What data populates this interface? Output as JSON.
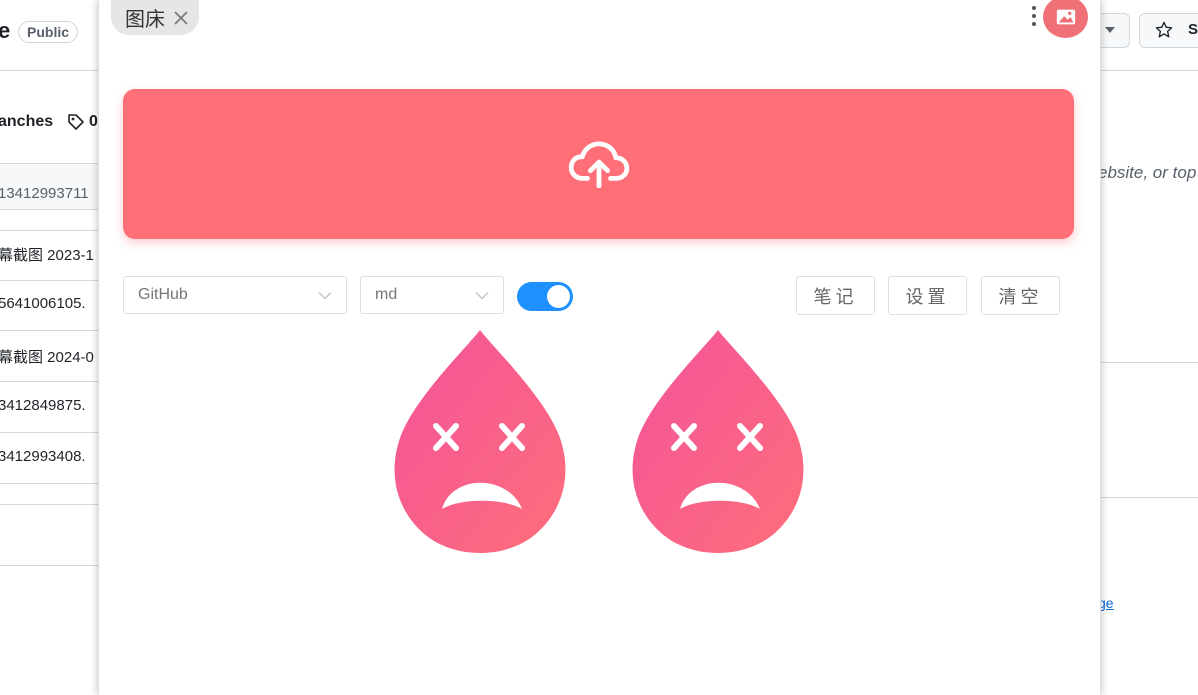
{
  "background": {
    "repo_name_fragment": "e",
    "visibility_badge": "Public",
    "branches_fragment": "anches",
    "tags_count_fragment": "0",
    "files": [
      "13412993711",
      "幕截图 2023-1",
      "5641006105.",
      "幕截图 2024-0",
      "3412849875.",
      "3412993408."
    ],
    "star_label_fragment": "St",
    "about_fragment": "ebsite, or top",
    "link_fragment": "ge"
  },
  "popup": {
    "tab_title": "图床",
    "host_select": {
      "value": "GitHub"
    },
    "format_select": {
      "value": "md"
    },
    "toggle": {
      "on": true
    },
    "buttons": {
      "notes": "笔记",
      "settings": "设置",
      "clear": "清空"
    }
  },
  "colors": {
    "upload_bg": "#ff6f77",
    "toggle_on": "#1e90ff",
    "drop_gradient_start": "#f2539a",
    "drop_gradient_end": "#ff6e7a"
  }
}
